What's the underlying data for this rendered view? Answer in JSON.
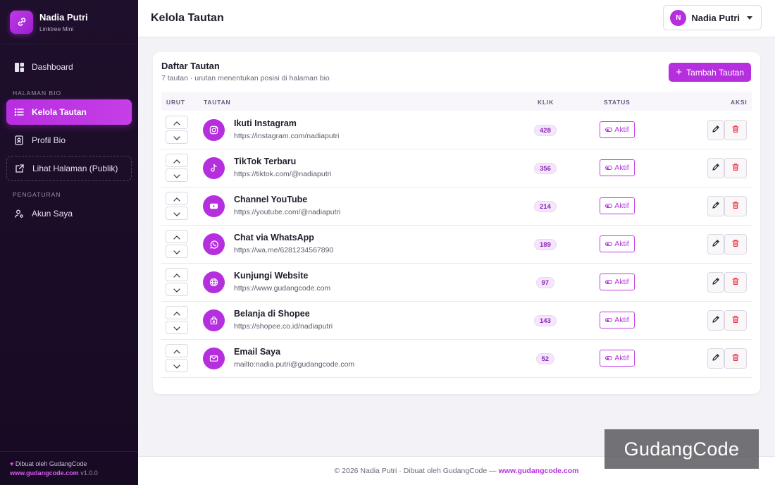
{
  "brand": {
    "name": "Nadia Putri",
    "subtitle": "Linktree Mini",
    "icon": "link-icon"
  },
  "nav": {
    "dashboard": "Dashboard",
    "section_bio": "HALAMAN BIO",
    "kelola": "Kelola Tautan",
    "profil": "Profil Bio",
    "lihat": "Lihat Halaman (Publik)",
    "section_settings": "PENGATURAN",
    "akun": "Akun Saya"
  },
  "sidebar_footer": {
    "heart": "♥",
    "made_by": "Dibuat oleh GudangCode",
    "site": "www.gudangcode.com",
    "version": "v1.0.0"
  },
  "header": {
    "title": "Kelola Tautan",
    "user_initial": "N",
    "user_name": "Nadia Putri"
  },
  "card": {
    "title": "Daftar Tautan",
    "subtitle": "7 tautan · urutan menentukan posisi di halaman bio",
    "add_label": "Tambah Tautan"
  },
  "table": {
    "columns": {
      "order": "URUT",
      "link": "TAUTAN",
      "clicks": "KLIK",
      "status": "STATUS",
      "actions": "AKSI"
    },
    "rows": [
      {
        "title": "Ikuti Instagram",
        "url": "https://instagram.com/nadiaputri",
        "clicks": "428",
        "status": "Aktif",
        "icon": "instagram-icon"
      },
      {
        "title": "TikTok Terbaru",
        "url": "https://tiktok.com/@nadiaputri",
        "clicks": "356",
        "status": "Aktif",
        "icon": "tiktok-icon"
      },
      {
        "title": "Channel YouTube",
        "url": "https://youtube.com/@nadiaputri",
        "clicks": "214",
        "status": "Aktif",
        "icon": "youtube-icon"
      },
      {
        "title": "Chat via WhatsApp",
        "url": "https://wa.me/6281234567890",
        "clicks": "189",
        "status": "Aktif",
        "icon": "whatsapp-icon"
      },
      {
        "title": "Kunjungi Website",
        "url": "https://www.gudangcode.com",
        "clicks": "97",
        "status": "Aktif",
        "icon": "globe-icon"
      },
      {
        "title": "Belanja di Shopee",
        "url": "https://shopee.co.id/nadiaputri",
        "clicks": "143",
        "status": "Aktif",
        "icon": "shopping-bag-icon"
      },
      {
        "title": "Email Saya",
        "url": "mailto:nadia.putri@gudangcode.com",
        "clicks": "52",
        "status": "Aktif",
        "icon": "mail-icon"
      }
    ]
  },
  "footer": {
    "text": "© 2026 Nadia Putri · Dibuat oleh GudangCode —",
    "site": "www.gudangcode.com"
  },
  "watermark": "GudangCode",
  "colors": {
    "accent": "#b62fde",
    "sidebar": "#1e0f2c",
    "danger": "#e0344a"
  }
}
